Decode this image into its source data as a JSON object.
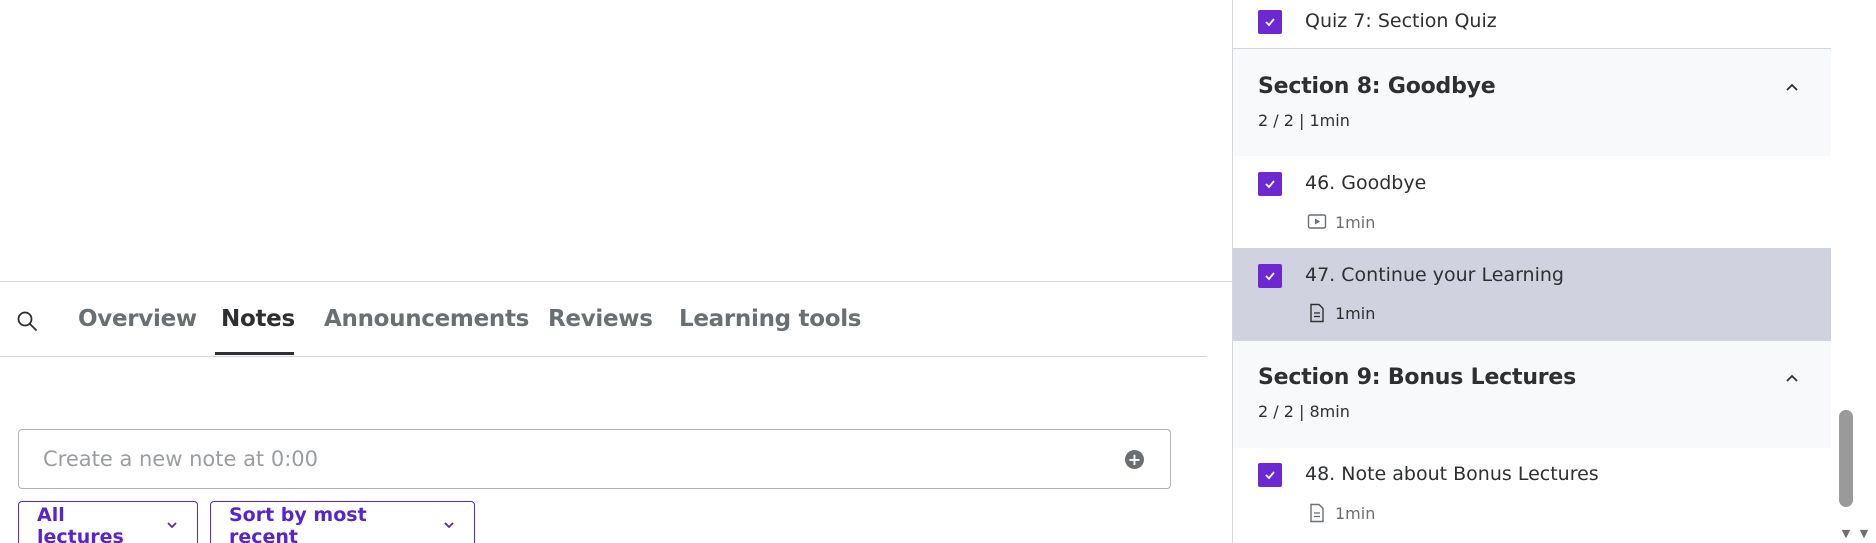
{
  "tabs": {
    "items": [
      {
        "label": "Overview"
      },
      {
        "label": "Notes"
      },
      {
        "label": "Announcements"
      },
      {
        "label": "Reviews"
      },
      {
        "label": "Learning tools"
      }
    ],
    "active": "Notes"
  },
  "notes": {
    "placeholder": "Create a new note at 0:00",
    "filter_lectures": "All lectures",
    "filter_sort": "Sort by most recent"
  },
  "sidebar": {
    "top_item": {
      "title": "Quiz 7: Section Quiz"
    },
    "sections": [
      {
        "title": "Section 8: Goodbye",
        "meta": "2 / 2 | 1min",
        "lectures": [
          {
            "title": "46. Goodbye",
            "duration": "1min",
            "icon": "video-icon",
            "completed": true
          },
          {
            "title": "47. Continue your Learning",
            "duration": "1min",
            "icon": "article-icon",
            "completed": true,
            "current": true
          }
        ]
      },
      {
        "title": "Section 9: Bonus Lectures",
        "meta": "2 / 2 | 8min",
        "lectures": [
          {
            "title": "48. Note about Bonus Lectures",
            "duration": "1min",
            "icon": "article-icon",
            "completed": true
          }
        ]
      }
    ]
  },
  "colors": {
    "accent": "#5624d0",
    "checkbox": "#6d28d2",
    "active_row": "#d1d2e0",
    "section_bg": "#f7f9fa"
  }
}
